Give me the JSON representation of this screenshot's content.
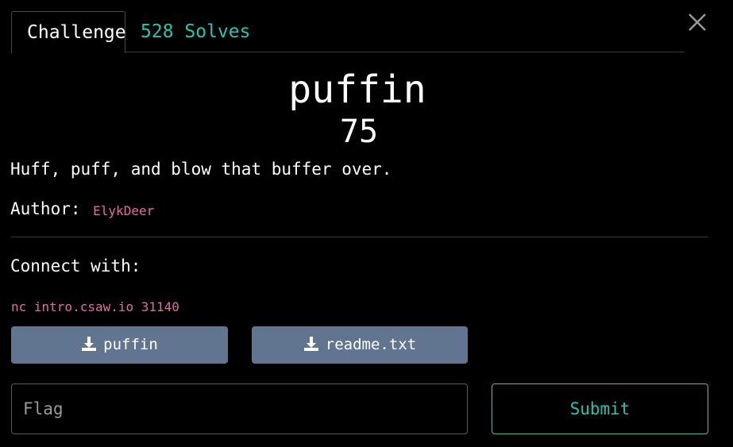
{
  "tabs": {
    "challenge_label": "Challenge",
    "solves_label": "528 Solves"
  },
  "challenge": {
    "name": "puffin",
    "points": "75",
    "description": "Huff, puff, and blow that buffer over.",
    "author_label": "Author:",
    "author_name": "ElykDeer",
    "connect_label": "Connect with:",
    "connect_command": "nc intro.csaw.io 31140"
  },
  "downloads": [
    {
      "label": "puffin",
      "icon": "download-icon"
    },
    {
      "label": "readme.txt",
      "icon": "download-icon"
    }
  ],
  "flag_form": {
    "placeholder": "Flag",
    "value": "",
    "submit_label": "Submit"
  },
  "colors": {
    "background": "#000000",
    "accent": "#27c4b4",
    "author": "#e06ea6",
    "download_button": "#617591"
  },
  "icons": {
    "close": "close-icon"
  }
}
